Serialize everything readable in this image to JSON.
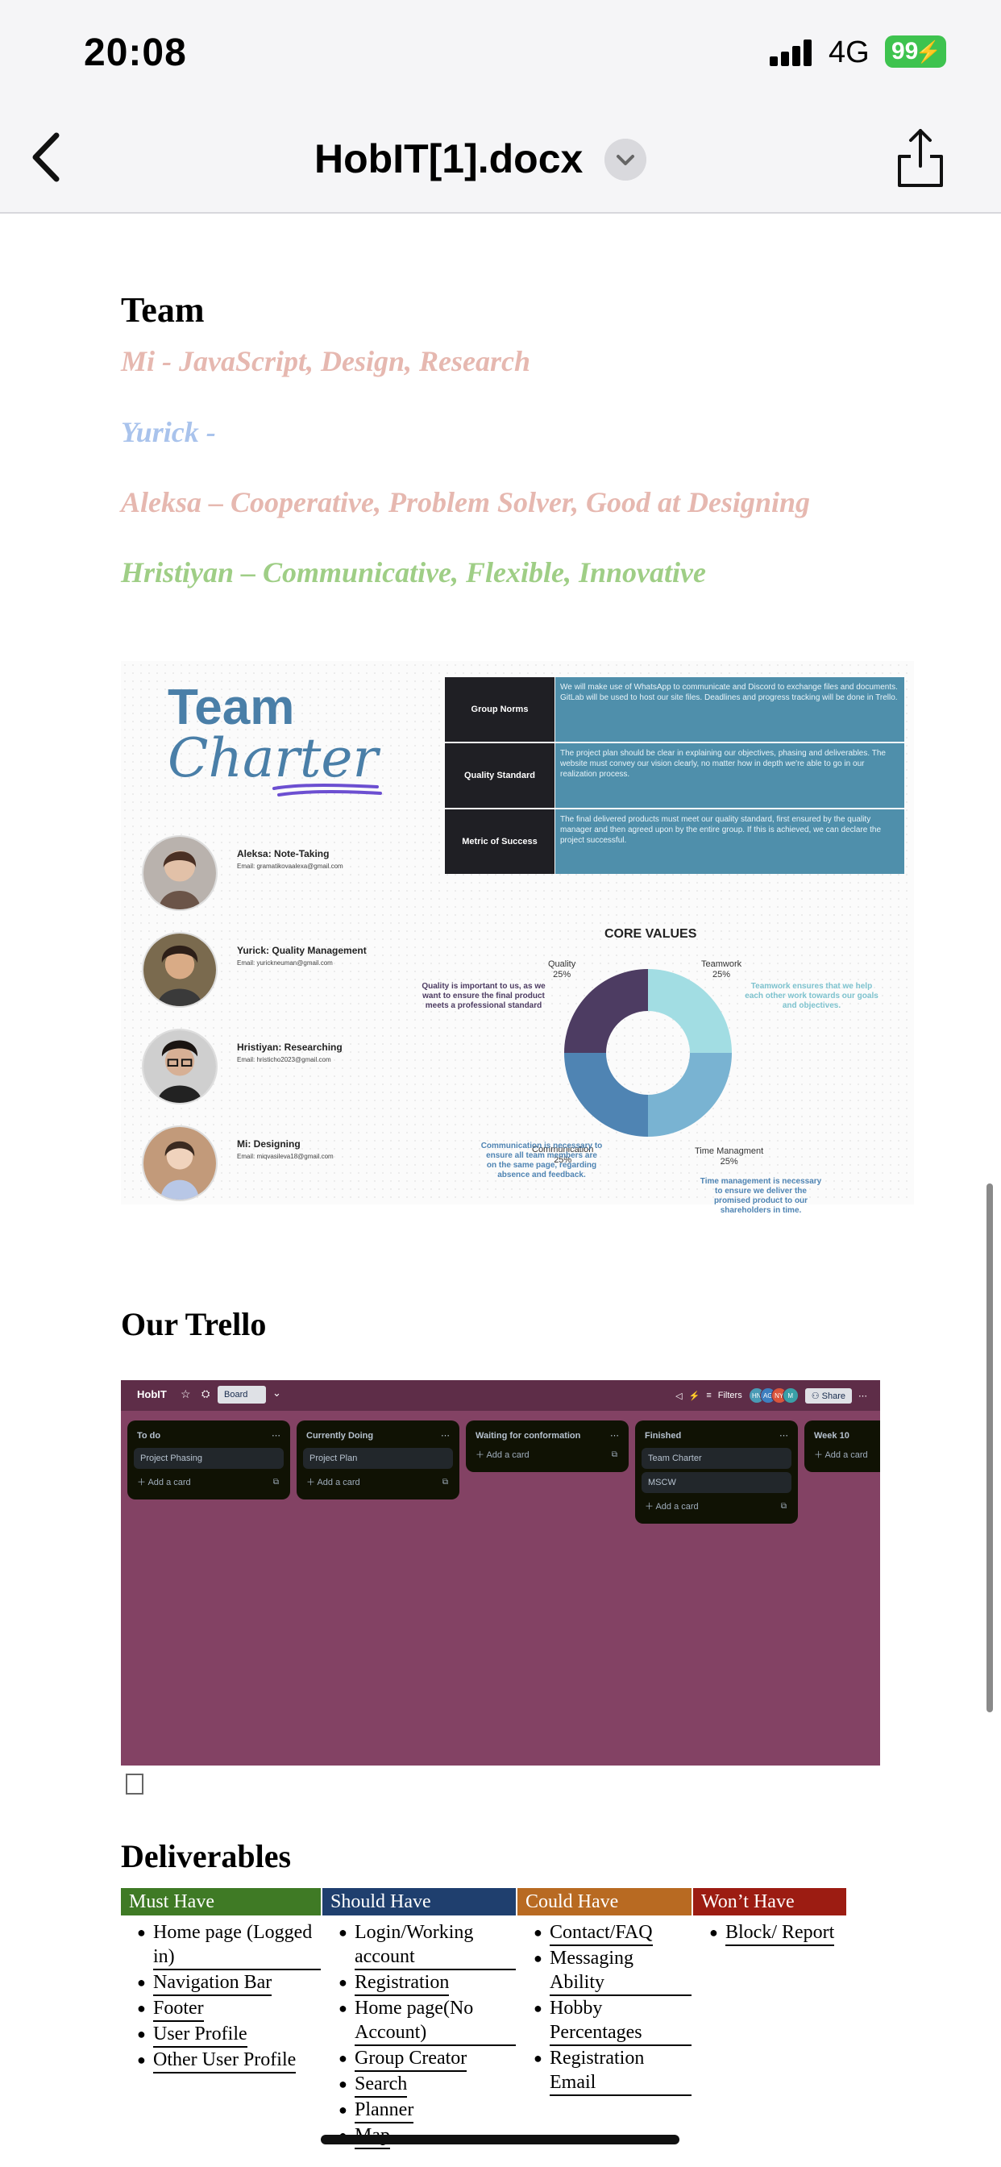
{
  "status_bar": {
    "time": "20:08",
    "network": "4G",
    "battery": "99"
  },
  "nav": {
    "title": "HobIT[1].docx"
  },
  "team": {
    "heading": "Team",
    "members": [
      {
        "text": "Mi - JavaScript, Design, Research",
        "color": "#e6b8b0"
      },
      {
        "text": "Yurick -",
        "color": "#a9c3ec"
      },
      {
        "text": "Aleksa – Cooperative, Problem Solver, Good at Designing",
        "color": "#e6b8b0"
      },
      {
        "text": "Hristiyan – Communicative, Flexible, Innovative",
        "color": "#9fce86"
      }
    ]
  },
  "charter": {
    "title_line1": "Team",
    "title_line2": "Charter",
    "norms": [
      {
        "label": "Group Norms",
        "text": "We will make use of WhatsApp to communicate and Discord to exchange files and documents. GitLab will be used to host our site files. Deadlines and progress tracking will be done in Trello."
      },
      {
        "label": "Quality Standard",
        "text": "The project plan should be clear in explaining our objectives, phasing and deliverables. The website must convey our vision clearly, no matter how in depth we're able to go in our realization process."
      },
      {
        "label": "Metric of Success",
        "text": "The final delivered products must meet our quality standard, first ensured by the quality manager and then agreed upon by the entire group. If this is achieved, we can declare the project successful."
      }
    ],
    "members": [
      {
        "name": "Aleksa: Note-Taking",
        "email": "Email: gramatikovaalexa@gmail.com"
      },
      {
        "name": "Yurick: Quality Management",
        "email": "Email: yurickneuman@gmail.com"
      },
      {
        "name": "Hristiyan: Researching",
        "email": "Email: hristicho2023@gmail.com"
      },
      {
        "name": "Mi: Designing",
        "email": "Email: miqvasileva18@gmail.com"
      }
    ],
    "core_values": {
      "title": "CORE VALUES",
      "labels": {
        "quality": "Quality",
        "teamwork": "Teamwork",
        "communication": "Communication",
        "time": "Time Managment",
        "pct": "25%"
      },
      "notes": {
        "quality": "Quality is important to us, as we want to ensure the final product meets a professional standard",
        "teamwork": "Teamwork ensures that we help each other work towards our goals and objectives.",
        "communication": "Communication is necessary to ensure all team members are on the same page, regarding absence and feedback.",
        "time": "Time management is necessary to ensure we deliver the promised product to our shareholders in time."
      },
      "chart_data": {
        "type": "pie",
        "title": "CORE VALUES",
        "categories": [
          "Quality",
          "Teamwork",
          "Time Managment",
          "Communication"
        ],
        "values": [
          25,
          25,
          25,
          25
        ],
        "colors": [
          "#4d3c62",
          "#a2dde3",
          "#79b3d2",
          "#4f84b3"
        ]
      }
    }
  },
  "trello_section": {
    "heading": "Our Trello",
    "board": {
      "name": "HobIT",
      "view": "Board",
      "filters": "Filters",
      "share": "Share",
      "avatars": [
        {
          "initials": "HN",
          "color": "#4a9bb5"
        },
        {
          "initials": "AG",
          "color": "#3d7fbf"
        },
        {
          "initials": "NY",
          "color": "#d9553b"
        },
        {
          "initials": "M",
          "color": "#3aa0a8"
        }
      ],
      "add_card": "Add a card",
      "lists": [
        {
          "title": "To do",
          "cards": [
            "Project Phasing"
          ]
        },
        {
          "title": "Currently Doing",
          "cards": [
            "Project Plan"
          ]
        },
        {
          "title": "Waiting for conformation",
          "cards": []
        },
        {
          "title": "Finished",
          "cards": [
            "Team Charter",
            "MSCW"
          ]
        },
        {
          "title": "Week 10",
          "cards": []
        }
      ]
    }
  },
  "deliverables": {
    "heading": "Deliverables",
    "columns": [
      {
        "header": "Must Have",
        "color": "#3f7a25",
        "items": [
          "Home page (Logged in)",
          "Navigation Bar",
          "Footer",
          "User Profile",
          "Other User Profile"
        ]
      },
      {
        "header": "Should Have",
        "color": "#1f3f6e",
        "items": [
          "Login/Working account",
          "Registration",
          "Home page(No Account)",
          "Group Creator",
          "Search",
          "Planner",
          "Map"
        ]
      },
      {
        "header": "Could Have",
        "color": "#b86a22",
        "items": [
          "Contact/FAQ",
          "Messaging Ability",
          "Hobby Percentages",
          "Registration Email"
        ]
      },
      {
        "header": "Won’t Have",
        "color": "#9c1c12",
        "items": [
          "Block/ Report"
        ]
      }
    ]
  }
}
